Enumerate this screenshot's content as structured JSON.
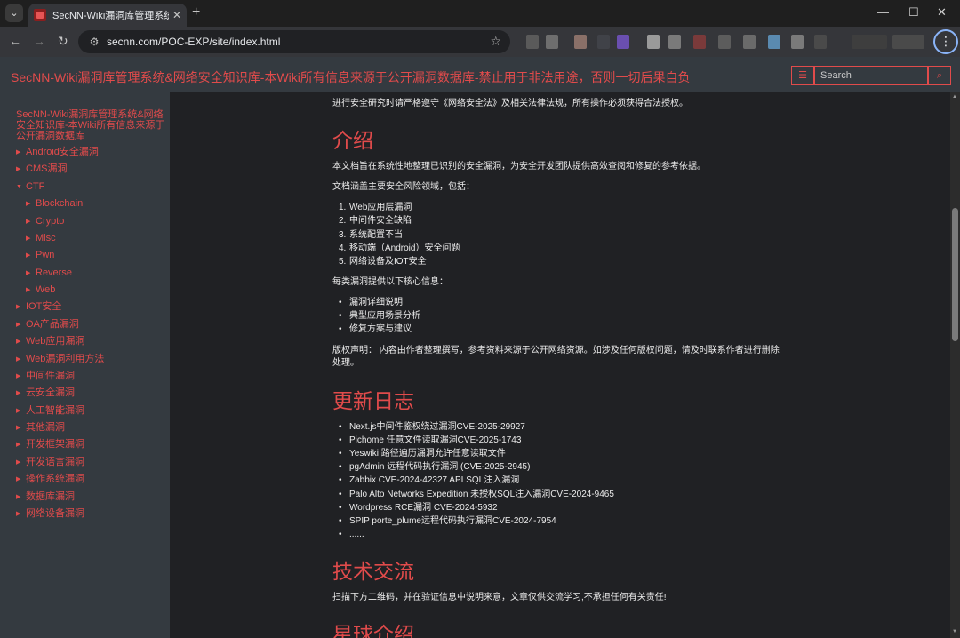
{
  "browser": {
    "tab_title": "SecNN-Wiki漏洞库管理系统&",
    "url": "secnn.com/POC-EXP/site/index.html"
  },
  "header": {
    "site_title": "SecNN-Wiki漏洞库管理系统&网络安全知识库-本Wiki所有信息来源于公开漏洞数据库-禁止用于非法用途，否则一切后果自负",
    "search_placeholder": "Search",
    "accent_color": "#e14b4b"
  },
  "sidebar": {
    "title": "SecNN-Wiki漏洞库管理系统&网络安全知识库-本Wiki所有信息来源于公开漏洞数据库",
    "items": [
      {
        "label": "Android安全漏洞",
        "expanded": false
      },
      {
        "label": "CMS漏洞",
        "expanded": false
      },
      {
        "label": "CTF",
        "expanded": true
      },
      {
        "label": "Blockchain",
        "expanded": false
      },
      {
        "label": "Crypto",
        "expanded": false
      },
      {
        "label": "Misc",
        "expanded": false
      },
      {
        "label": "Pwn",
        "expanded": false
      },
      {
        "label": "Reverse",
        "expanded": false
      },
      {
        "label": "Web",
        "expanded": false
      },
      {
        "label": "IOT安全",
        "expanded": false
      },
      {
        "label": "OA产品漏洞",
        "expanded": false
      },
      {
        "label": "Web应用漏洞",
        "expanded": false
      },
      {
        "label": "Web漏洞利用方法",
        "expanded": false
      },
      {
        "label": "中间件漏洞",
        "expanded": false
      },
      {
        "label": "云安全漏洞",
        "expanded": false
      },
      {
        "label": "人工智能漏洞",
        "expanded": false
      },
      {
        "label": "其他漏洞",
        "expanded": false
      },
      {
        "label": "开发框架漏洞",
        "expanded": false
      },
      {
        "label": "开发语言漏洞",
        "expanded": false
      },
      {
        "label": "操作系统漏洞",
        "expanded": false
      },
      {
        "label": "数据库漏洞",
        "expanded": false
      },
      {
        "label": "网络设备漏洞",
        "expanded": false
      }
    ]
  },
  "content": {
    "intro_top": "进行安全研究时请严格遵守《网络安全法》及相关法律法规，所有操作必须获得合法授权。",
    "h_intro": "介绍",
    "intro_p1": "本文档旨在系统性地整理已识别的安全漏洞，为安全开发团队提供高效查阅和修复的参考依据。",
    "intro_p2": "文档涵盖主要安全风险领域，包括：",
    "areas": [
      "Web应用层漏洞",
      "中间件安全缺陷",
      "系统配置不当",
      "移动端（Android）安全问题",
      "网络设备及IOT安全"
    ],
    "intro_p3": "每类漏洞提供以下核心信息：",
    "info_items": [
      "漏洞详细说明",
      "典型应用场景分析",
      "修复方案与建议"
    ],
    "copyright": "版权声明： 内容由作者整理撰写，参考资料来源于公开网络资源。如涉及任何版权问题，请及时联系作者进行删除处理。",
    "h_changelog": "更新日志",
    "changelog": [
      "Next.js中间件鉴权绕过漏洞CVE-2025-29927",
      "Pichome 任意文件读取漏洞CVE-2025-1743",
      "Yeswiki 路径遍历漏洞允许任意读取文件",
      "pgAdmin 远程代码执行漏洞 (CVE-2025-2945)",
      "Zabbix CVE-2024-42327 API SQL注入漏洞",
      "Palo Alto Networks Expedition 未授权SQL注入漏洞CVE-2024-9465",
      "Wordpress RCE漏洞 CVE-2024-5932",
      "SPIP porte_plume远程代码执行漏洞CVE-2024-7954",
      "......"
    ],
    "h_exchange": "技术交流",
    "exchange_p": "扫描下方二维码，并在验证信息中说明来意，文章仅供交流学习,不承担任何有关责任!",
    "h_planet": "星球介绍"
  }
}
